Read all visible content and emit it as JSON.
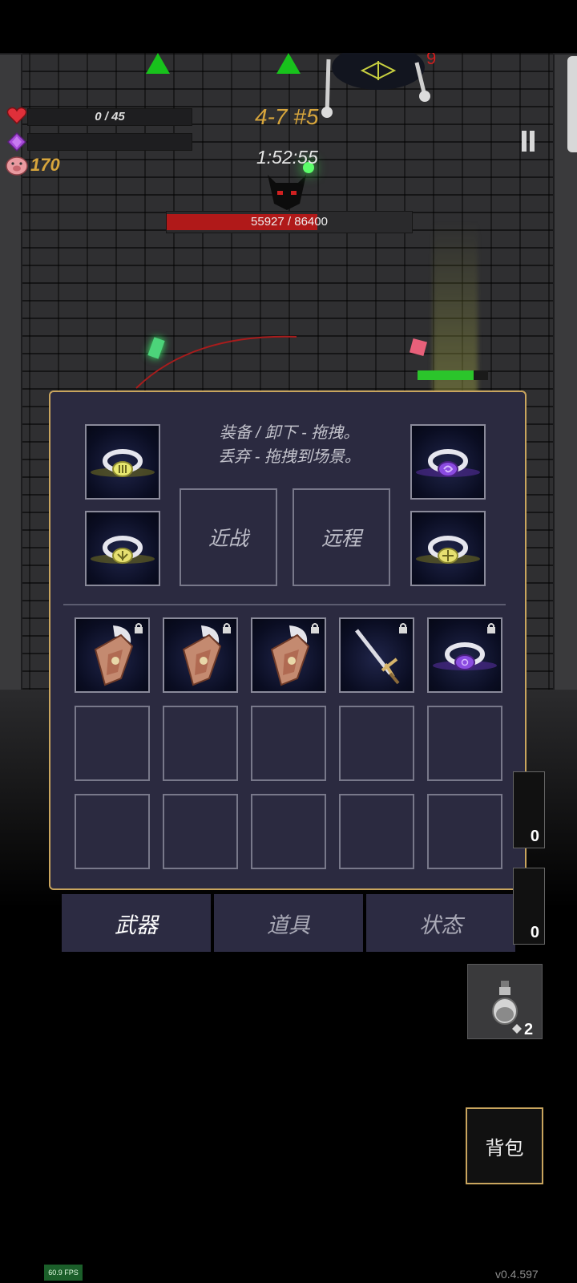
{
  "hud": {
    "health_text": "0 / 45",
    "coins": "170",
    "stage": "4-7 #5",
    "timer": "1:52:55",
    "boss_hp_text": "55927 / 86400",
    "boss_hp_current": 55927,
    "boss_hp_max": 86400,
    "boss_damage_number": "9"
  },
  "panel": {
    "instruction_line1": "装备 / 卸下 - 拖拽。",
    "instruction_line2": "丢弃 - 拖拽到场景。",
    "melee_label": "近战",
    "ranged_label": "远程",
    "equipped_left": [
      {
        "item": "silver-ring-yellow-gem",
        "gem_color": "#e8e870"
      },
      {
        "item": "silver-ring-yellow-leaf-gem",
        "gem_color": "#e6e070"
      }
    ],
    "equipped_right": [
      {
        "item": "silver-ring-purple-swirl-gem",
        "gem_color": "#8a4be0"
      },
      {
        "item": "silver-ring-yellow-cross-gem",
        "gem_color": "#e6e070"
      }
    ],
    "inventory": [
      {
        "item": "winged-shield",
        "locked": true
      },
      {
        "item": "winged-shield",
        "locked": true
      },
      {
        "item": "winged-shield",
        "locked": true
      },
      {
        "item": "ornate-sword",
        "locked": true
      },
      {
        "item": "silver-ring-purple-gem",
        "locked": true
      },
      null,
      null,
      null,
      null,
      null,
      null,
      null,
      null,
      null,
      null
    ]
  },
  "tabs": [
    {
      "label": "武器",
      "active": true
    },
    {
      "label": "道具",
      "active": false
    },
    {
      "label": "状态",
      "active": false
    }
  ],
  "side_slots": {
    "slot1_count": "0",
    "slot2_count": "0",
    "potion_count": "2"
  },
  "bag_button_label": "背包",
  "fps": "60.9 FPS",
  "version": "v0.4.597",
  "colors": {
    "gold": "#c9a55e",
    "panel_bg": "#2b2a40",
    "hp_red": "#b01919",
    "stage_gold": "#d7a53c",
    "green_marker": "#18c21c"
  }
}
